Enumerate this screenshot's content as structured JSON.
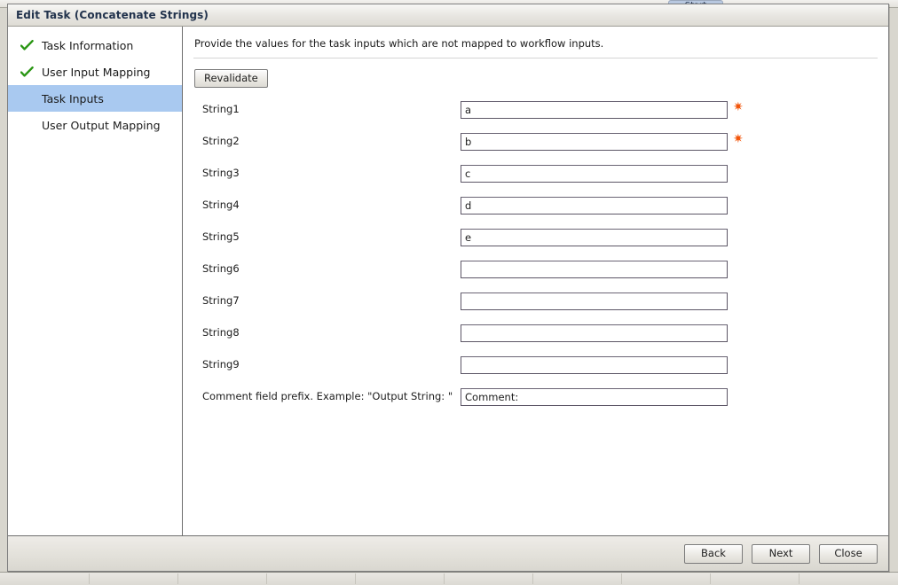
{
  "background": {
    "tab_label": "Start"
  },
  "window": {
    "title": "Edit Task (Concatenate Strings)"
  },
  "sidebar": {
    "items": [
      {
        "label": "Task Information",
        "state": "completed",
        "icon": "checkmark-icon"
      },
      {
        "label": "User Input Mapping",
        "state": "completed",
        "icon": "checkmark-icon"
      },
      {
        "label": "Task Inputs",
        "state": "selected",
        "icon": ""
      },
      {
        "label": "User Output Mapping",
        "state": "pending",
        "icon": ""
      }
    ]
  },
  "content": {
    "description": "Provide the values for the task inputs which are not mapped to workflow inputs.",
    "revalidate_label": "Revalidate",
    "required_marker": "✷",
    "fields": [
      {
        "label": "String1",
        "value": "a",
        "required": true
      },
      {
        "label": "String2",
        "value": "b",
        "required": true
      },
      {
        "label": "String3",
        "value": "c",
        "required": false
      },
      {
        "label": "String4",
        "value": "d",
        "required": false
      },
      {
        "label": "String5",
        "value": "e",
        "required": false
      },
      {
        "label": "String6",
        "value": "",
        "required": false
      },
      {
        "label": "String7",
        "value": "",
        "required": false
      },
      {
        "label": "String8",
        "value": "",
        "required": false
      },
      {
        "label": "String9",
        "value": "",
        "required": false
      },
      {
        "label": "Comment field prefix.  Example: \"Output String: \"",
        "value": "Comment:",
        "required": false
      }
    ]
  },
  "footer": {
    "back_label": "Back",
    "next_label": "Next",
    "close_label": "Close"
  },
  "colors": {
    "selection_blue": "#a9c9f0",
    "checkmark_green": "#2a9614",
    "required_orange": "#f2550a",
    "title_text": "#22334d"
  }
}
